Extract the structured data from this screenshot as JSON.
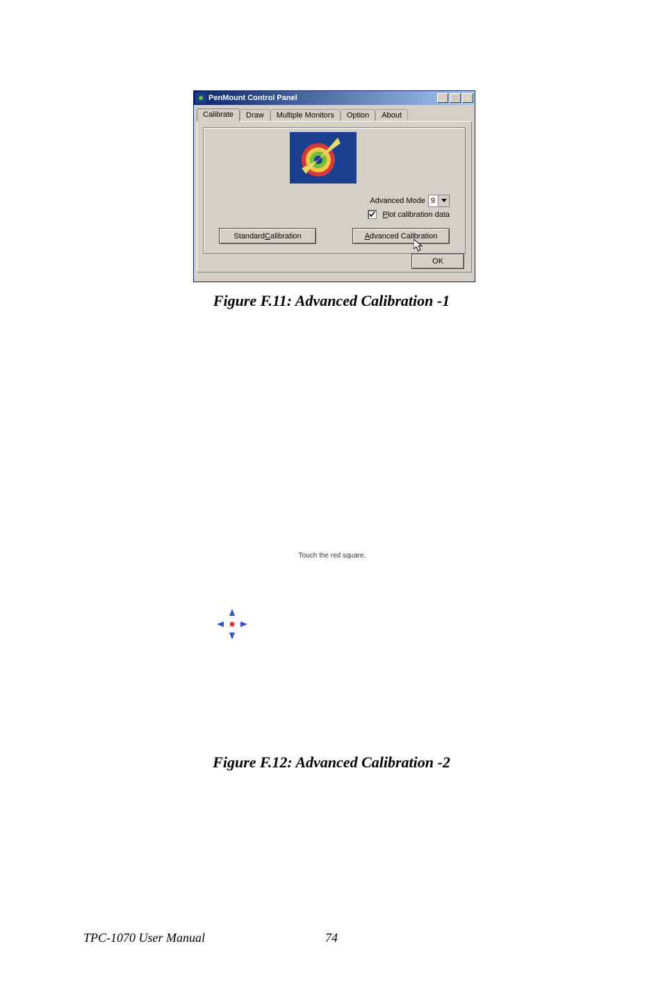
{
  "dialog": {
    "title": "PenMount Control Panel",
    "window_buttons": {
      "minimize": "_",
      "maximize": "□",
      "close": "×"
    },
    "tabs": [
      {
        "label": "Calibrate",
        "active": true
      },
      {
        "label": "Draw",
        "active": false
      },
      {
        "label": "Multiple Monitors",
        "active": false
      },
      {
        "label": "Option",
        "active": false
      },
      {
        "label": "About",
        "active": false
      }
    ],
    "advanced_mode_label": "Advanced Mode",
    "advanced_mode_value": "9",
    "plot_checkbox_checked": true,
    "plot_checkbox_label_u": "P",
    "plot_checkbox_label_rest": "lot calibration data",
    "standard_btn_pre": "Standard ",
    "standard_btn_u": "C",
    "standard_btn_post": "alibration",
    "advanced_btn_u": "A",
    "advanced_btn_post": "dvanced Calibration",
    "ok_label": "OK"
  },
  "captions": {
    "fig1": "Figure F.11: Advanced Calibration -1",
    "fig2": "Figure F.12: Advanced Calibration -2"
  },
  "touch_screen": {
    "instruction": "Touch the red square."
  },
  "footer": {
    "manual": "TPC-1070 User Manual",
    "page": "74"
  }
}
